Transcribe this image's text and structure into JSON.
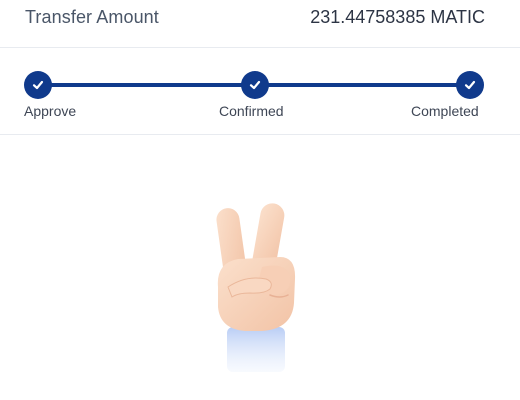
{
  "transfer": {
    "label": "Transfer Amount",
    "value": "231.44758385 MATIC"
  },
  "steps": [
    {
      "label": "Approve",
      "status": "done"
    },
    {
      "label": "Confirmed",
      "status": "done"
    },
    {
      "label": "Completed",
      "status": "done"
    }
  ],
  "colors": {
    "accent": "#103a8c",
    "divider": "#e8ebf0"
  },
  "illustration": {
    "icon": "victory-hand-icon"
  }
}
